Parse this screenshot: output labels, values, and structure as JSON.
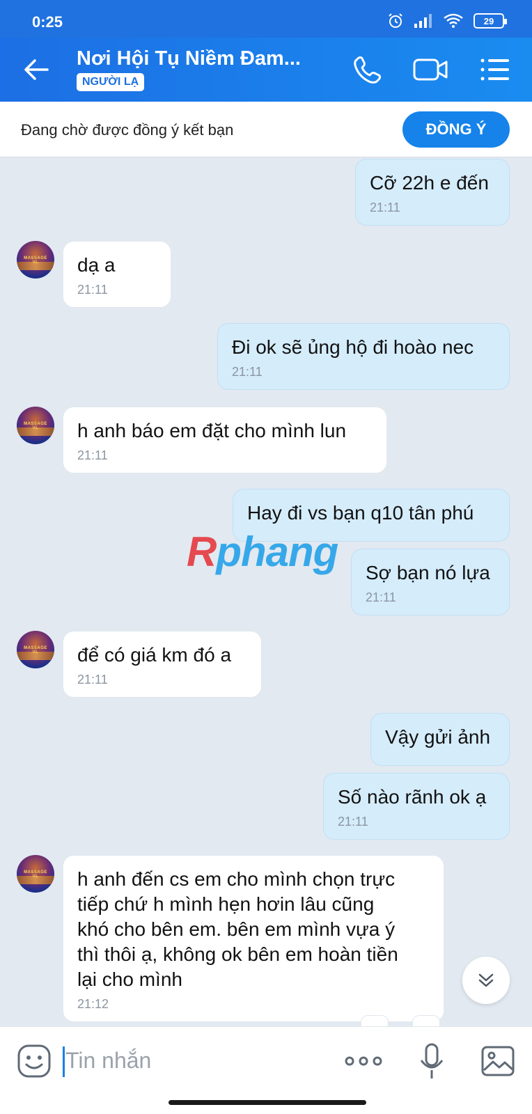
{
  "status_bar": {
    "time": "0:25",
    "battery": "29"
  },
  "header": {
    "title": "Nơi Hội Tụ Niềm Đam...",
    "badge": "NGƯỜI LẠ"
  },
  "friend_request": {
    "text": "Đang chờ được đồng ý kết bạn",
    "accept_label": "ĐỒNG Ý"
  },
  "messages": [
    {
      "side": "out",
      "lines": [
        "Cỡ 22h e đến"
      ],
      "time": "21:11"
    },
    {
      "side": "in",
      "lines": [
        "dạ a"
      ],
      "time": "21:11"
    },
    {
      "side": "out",
      "lines": [
        "Đi ok sẽ ủng hộ đi hoào nec"
      ],
      "time": "21:11"
    },
    {
      "side": "in",
      "lines": [
        "h anh báo em đặt cho mình lun"
      ],
      "time": "21:11"
    },
    {
      "side": "out",
      "lines": [
        "Hay đi vs bạn q10 tân phú"
      ],
      "time": ""
    },
    {
      "side": "out",
      "lines": [
        "Sợ bạn nó lựa"
      ],
      "time": "21:11"
    },
    {
      "side": "in",
      "lines": [
        "để có giá km đó a"
      ],
      "time": "21:11"
    },
    {
      "side": "out",
      "lines": [
        "Vậy gửi ảnh"
      ],
      "time": ""
    },
    {
      "side": "out",
      "lines": [
        "Số nào rãnh ok ạ"
      ],
      "time": "21:11"
    },
    {
      "side": "in",
      "lines": [
        "h anh đến cs em cho mình chọn trực",
        "tiếp chứ h mình hẹn hơin lâu cũng",
        "khó cho bên em. bên em mình vựa ý",
        "thì thôi ạ, không ok bên em hoàn tiền",
        "lại cho mình"
      ],
      "time": "21:12"
    }
  ],
  "avatar_text": "MASSAGE VL",
  "watermark": {
    "first": "R",
    "rest": "phang"
  },
  "input": {
    "placeholder": "Tin nhắn"
  },
  "icons": {
    "back": "back-arrow-icon",
    "call": "phone-icon",
    "video": "video-camera-icon",
    "menu": "menu-list-icon",
    "emoji": "emoji-icon",
    "more": "more-dots-icon",
    "mic": "microphone-icon",
    "gallery": "image-gallery-icon",
    "scroll": "chevron-double-down-icon"
  },
  "colors": {
    "header": "#1c6fe4",
    "accent": "#1683ea",
    "outgoing_bubble": "#d5ecfb",
    "incoming_bubble": "#ffffff",
    "background": "#e2e9f1"
  }
}
